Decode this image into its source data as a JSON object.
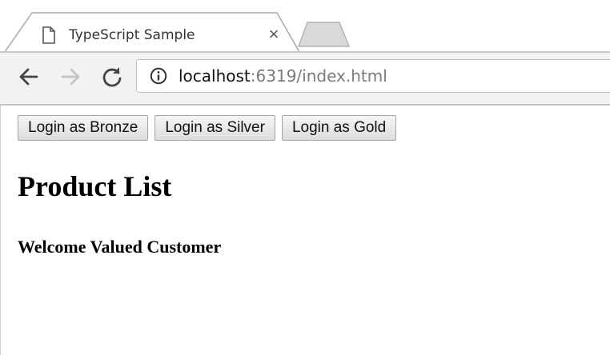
{
  "browser": {
    "tab": {
      "title": "TypeScript Sample",
      "close_glyph": "×",
      "icon": "page-icon"
    },
    "new_tab_icon": "new-tab-icon",
    "toolbar": {
      "back_icon": "back-arrow-icon",
      "forward_icon": "forward-arrow-icon",
      "reload_icon": "reload-icon",
      "site_info_icon": "info-icon",
      "url_host": "localhost",
      "url_rest": ":6319/index.html"
    }
  },
  "page": {
    "buttons": [
      "Login as Bronze",
      "Login as Silver",
      "Login as Gold"
    ],
    "heading": "Product List",
    "subheading": "Welcome Valued Customer"
  },
  "colors": {
    "toolbar_bg": "#f2f2f2",
    "url_host": "#111111",
    "url_rest": "#7a7a7a",
    "button_border": "#a6a6a6"
  }
}
